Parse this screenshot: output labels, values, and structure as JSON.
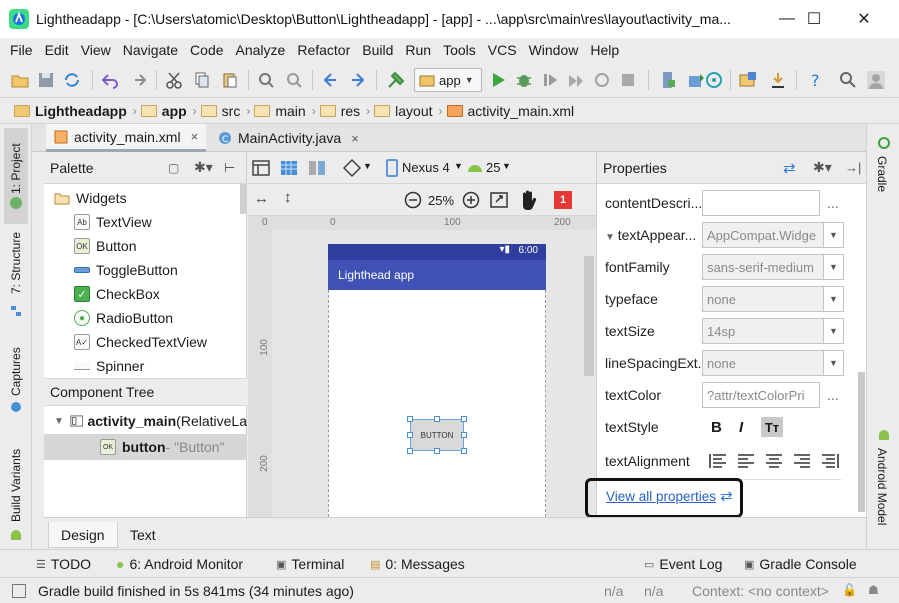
{
  "window": {
    "title": "Lightheadapp - [C:\\Users\\atomic\\Desktop\\Button\\Lightheadapp] - [app] - ...\\app\\src\\main\\res\\layout\\activity_ma...",
    "minimize": "—",
    "maximize": "☐",
    "close": "✕"
  },
  "menu": [
    "File",
    "Edit",
    "View",
    "Navigate",
    "Code",
    "Analyze",
    "Refactor",
    "Build",
    "Run",
    "Tools",
    "VCS",
    "Window",
    "Help"
  ],
  "toolbar": {
    "run_config": "app"
  },
  "breadcrumb": [
    "Lightheadapp",
    "app",
    "src",
    "main",
    "res",
    "layout",
    "activity_main.xml"
  ],
  "left_strip": {
    "project": "1: Project",
    "structure": "7: Structure",
    "captures": "Captures",
    "build_variants": "Build Variants"
  },
  "right_strip": {
    "gradle": "Gradle",
    "android_model": "Android Model"
  },
  "editor_tabs": [
    {
      "label": "activity_main.xml",
      "close": "×"
    },
    {
      "label": "MainActivity.java",
      "close": "×"
    }
  ],
  "palette": {
    "title": "Palette",
    "category": "Widgets",
    "items": [
      "TextView",
      "Button",
      "ToggleButton",
      "CheckBox",
      "RadioButton",
      "CheckedTextView",
      "Spinner"
    ],
    "icons": [
      "Ab",
      "OK",
      "",
      "✓",
      "●",
      "A✓",
      ""
    ]
  },
  "component_tree": {
    "title": "Component Tree",
    "root_name": "activity_main",
    "root_type": " (RelativeLa",
    "child_name": "button",
    "child_text": " - \"Button\""
  },
  "design_toolbar": {
    "device": "Nexus 4",
    "api": "25",
    "zoom": "25%",
    "error_count": "1"
  },
  "canvas": {
    "ruler_top": [
      "0",
      "100",
      "200"
    ],
    "ruler_left": [
      "0",
      "100",
      "200"
    ],
    "status_time": "6:00",
    "app_bar_title": "Lighthead app",
    "button_text": "BUTTON",
    "appbar_color": "#3f51b5"
  },
  "properties": {
    "title": "Properties",
    "rows": [
      {
        "label": "contentDescri...",
        "value": "",
        "kind": "field"
      },
      {
        "label": "textAppear...",
        "value": "AppCompat.Widge",
        "kind": "combo"
      },
      {
        "label": "fontFamily",
        "value": "sans-serif-medium",
        "kind": "combo"
      },
      {
        "label": "typeface",
        "value": "none",
        "kind": "combo"
      },
      {
        "label": "textSize",
        "value": "14sp",
        "kind": "combo"
      },
      {
        "label": "lineSpacingExt...",
        "value": "none",
        "kind": "combo"
      },
      {
        "label": "textColor",
        "value": "?attr/textColorPri",
        "kind": "field"
      }
    ],
    "text_style_label": "textStyle",
    "text_style_buttons": [
      "B",
      "I",
      "Tт"
    ],
    "text_alignment_label": "textAlignment",
    "view_all": "View all properties",
    "dots": "..."
  },
  "design_tabs": [
    "Design",
    "Text"
  ],
  "tool_windows": [
    "TODO",
    "6: Android Monitor",
    "Terminal",
    "0: Messages",
    "Event Log",
    "Gradle Console"
  ],
  "status": {
    "message": "Gradle build finished in 5s 841ms (34 minutes ago)",
    "na1": "n/a",
    "na2": "n/a",
    "context": "Context: <no context>"
  }
}
